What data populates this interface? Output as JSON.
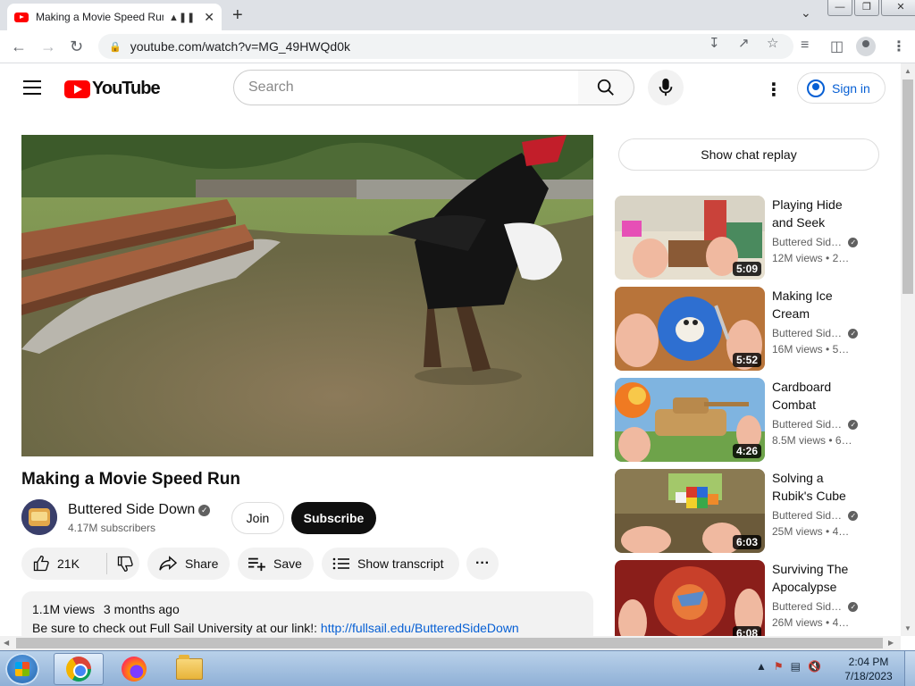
{
  "browser": {
    "tab_title": "Making a Movie Speed Run",
    "url": "youtube.com/watch?v=MG_49HWQd0k"
  },
  "header": {
    "logo_text": "YouTube",
    "search_placeholder": "Search",
    "signin_label": "Sign in"
  },
  "video": {
    "title": "Making a Movie Speed Run",
    "channel": "Buttered Side Down",
    "subscribers": "4.17M subscribers",
    "join_label": "Join",
    "subscribe_label": "Subscribe",
    "likes": "21K",
    "share_label": "Share",
    "save_label": "Save",
    "transcript_label": "Show transcript",
    "views": "1.1M views",
    "age": "3 months ago",
    "description_text": "Be sure to check out Full Sail University at our link!: ",
    "description_link": "http://fullsail.edu/ButteredSideDown"
  },
  "sidebar": {
    "chat_replay_label": "Show chat replay",
    "recommendations": [
      {
        "title": "Playing Hide and Seek",
        "channel": "Buttered Sid…",
        "views": "12M views",
        "age": "• 2…",
        "duration": "5:09"
      },
      {
        "title": "Making Ice Cream",
        "channel": "Buttered Sid…",
        "views": "16M views",
        "age": "• 5…",
        "duration": "5:52"
      },
      {
        "title": "Cardboard Combat",
        "channel": "Buttered Sid…",
        "views": "8.5M views",
        "age": "• 6…",
        "duration": "4:26"
      },
      {
        "title": "Solving a Rubik's Cube",
        "channel": "Buttered Sid…",
        "views": "25M views",
        "age": "• 4…",
        "duration": "6:03"
      },
      {
        "title": "Surviving The Apocalypse",
        "channel": "Buttered Sid…",
        "views": "26M views",
        "age": "• 4…",
        "duration": "6:08"
      }
    ]
  },
  "taskbar": {
    "time": "2:04 PM",
    "date": "7/18/2023"
  },
  "colors": {
    "youtube_red": "#ff0000",
    "link_blue": "#065fd4",
    "subscribe_black": "#0f0f0f",
    "pill_gray": "#f2f2f2"
  }
}
